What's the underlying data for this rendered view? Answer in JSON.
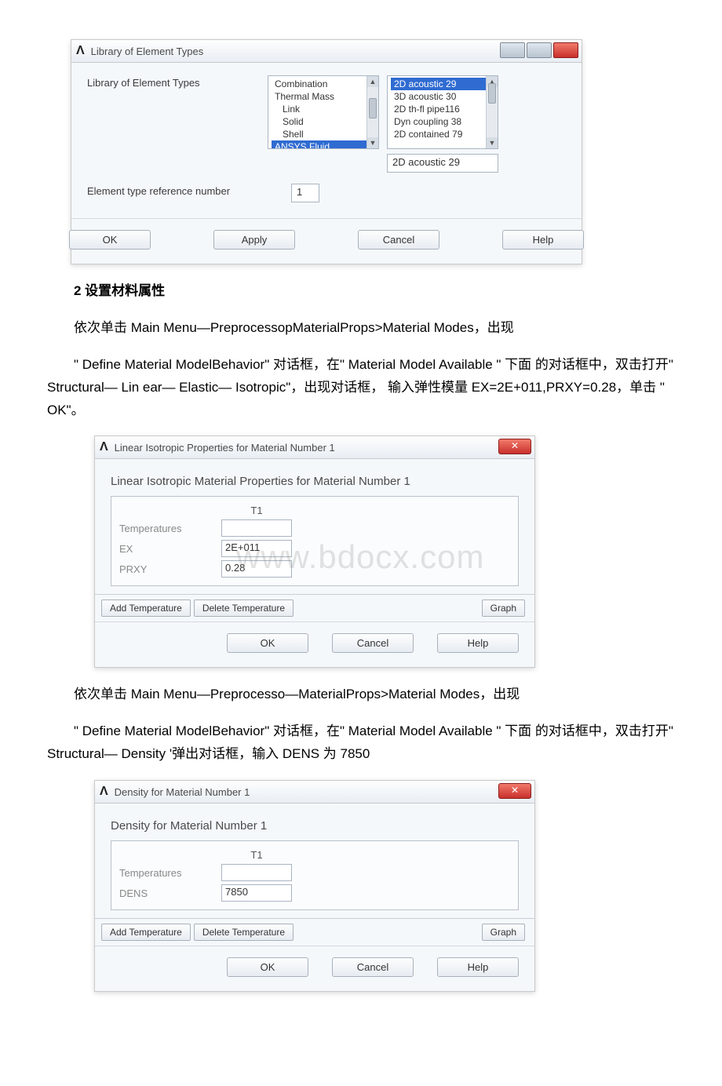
{
  "watermark": "www.bdocx.com",
  "doc": {
    "heading2": "2 设置材料属性",
    "p1": "依次单击 Main Menu—PreprocessopMaterialProps>Material Modes，出现",
    "p2": "\" Define Material ModelBehavior\" 对话框，在\" Material Model Available \" 下面 的对话框中，双击打开\" Structural— Lin ear— Elastic— Isotropic\"，出现对话框， 输入弹性模量 EX=2E+011,PRXY=0.28，单击 \" OK\"。",
    "p3": "依次单击 Main Menu—Preprocesso—MaterialProps>Material Modes，出现",
    "p4": "\" Define Material ModelBehavior\" 对话框，在\" Material Model Available \" 下面 的对话框中，双击打开\" Structural— Density '弹出对话框，输入 DENS 为 7850"
  },
  "dlg1": {
    "title": "Library of Element Types",
    "label_main": "Library of Element Types",
    "left_list": [
      "Combination",
      "Thermal Mass",
      "Link",
      "Solid",
      "Shell",
      "ANSYS Fluid"
    ],
    "right_list": [
      "2D acoustic   29",
      "3D acoustic   30",
      "2D th-fl pipe116",
      "Dyn coupling  38",
      "2D contained  79"
    ],
    "right_sel": "2D acoustic   29",
    "label_ref": "Element type reference number",
    "ref_value": "1",
    "btns": [
      "OK",
      "Apply",
      "Cancel",
      "Help"
    ]
  },
  "dlg2": {
    "title": "Linear Isotropic Properties for Material Number 1",
    "subtitle": "Linear Isotropic Material Properties for Material Number 1",
    "colhead": "T1",
    "rows": [
      {
        "label": "Temperatures",
        "value": ""
      },
      {
        "label": "EX",
        "value": "2E+011"
      },
      {
        "label": "PRXY",
        "value": "0.28"
      }
    ],
    "actions_left": [
      "Add Temperature",
      "Delete Temperature"
    ],
    "actions_right": "Graph",
    "btns": [
      "OK",
      "Cancel",
      "Help"
    ]
  },
  "dlg3": {
    "title": "Density for Material Number 1",
    "subtitle": "Density for Material Number 1",
    "colhead": "T1",
    "rows": [
      {
        "label": "Temperatures",
        "value": ""
      },
      {
        "label": "DENS",
        "value": "7850"
      }
    ],
    "actions_left": [
      "Add Temperature",
      "Delete Temperature"
    ],
    "actions_right": "Graph",
    "btns": [
      "OK",
      "Cancel",
      "Help"
    ]
  }
}
